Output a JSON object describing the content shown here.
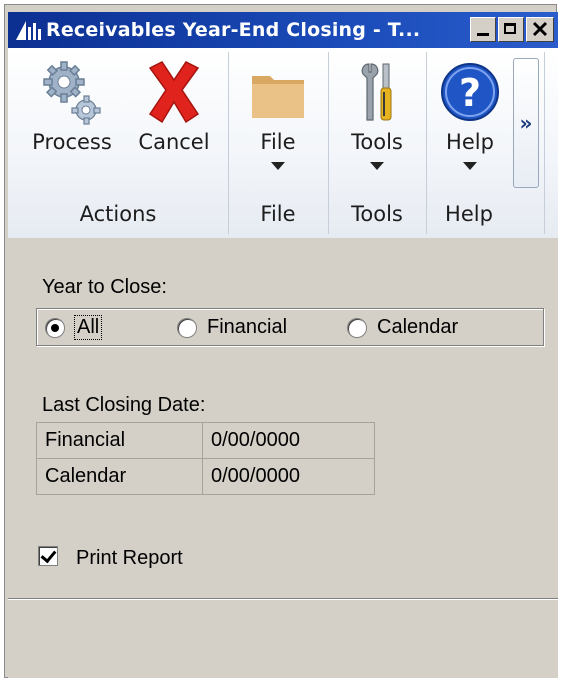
{
  "window": {
    "title": "Receivables Year-End Closing  -  T..."
  },
  "ribbon": {
    "groups": [
      {
        "label": "Actions",
        "buttons": [
          {
            "label": "Process",
            "icon": "gears-icon"
          },
          {
            "label": "Cancel",
            "icon": "red-x-icon"
          }
        ]
      },
      {
        "label": "File",
        "buttons": [
          {
            "label": "File",
            "icon": "folder-icon"
          }
        ]
      },
      {
        "label": "Tools",
        "buttons": [
          {
            "label": "Tools",
            "icon": "tools-icon"
          }
        ]
      },
      {
        "label": "Help",
        "buttons": [
          {
            "label": "Help",
            "icon": "help-icon"
          }
        ]
      }
    ],
    "overflow_label": "»"
  },
  "form": {
    "year_to_close_label": "Year to Close:",
    "radio_options": [
      "All",
      "Financial",
      "Calendar"
    ],
    "selected_option": "All",
    "last_closing_label": "Last Closing Date:",
    "closing_dates": [
      {
        "name": "Financial",
        "value": "0/00/0000"
      },
      {
        "name": "Calendar",
        "value": "0/00/0000"
      }
    ],
    "print_report_label": "Print Report",
    "print_report_checked": true
  }
}
